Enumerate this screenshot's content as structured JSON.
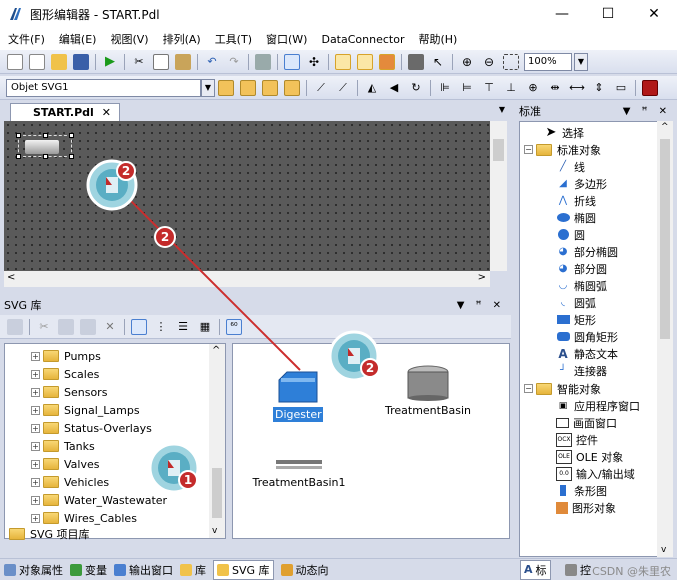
{
  "window": {
    "title": "图形编辑器 - START.Pdl",
    "minimize": "—",
    "maximize": "☐",
    "close": "✕"
  },
  "menu": [
    "文件(F)",
    "编辑(E)",
    "视图(V)",
    "排列(A)",
    "工具(T)",
    "窗口(W)",
    "DataConnector",
    "帮助(H)"
  ],
  "toolbar": {
    "zoom": "100%"
  },
  "objectbar": {
    "selected_object": "Objet SVG1"
  },
  "editor": {
    "tab_label": "START.Pdl",
    "tab_close": "✕"
  },
  "svg_library": {
    "title": "SVG 库",
    "folders": [
      "Pumps",
      "Scales",
      "Sensors",
      "Signal_Lamps",
      "Status-Overlays",
      "Tanks",
      "Valves",
      "Vehicles",
      "Water_Wastewater",
      "Wires_Cables"
    ],
    "project_lib": "SVG 项目库",
    "items": [
      "Digester",
      "TreatmentBasin",
      "TreatmentBasin1"
    ]
  },
  "callouts": [
    "1",
    "2",
    "2",
    "2"
  ],
  "standard_panel": {
    "title": "标准",
    "items": [
      {
        "label": "选择",
        "icon": "arrow-pointer-icon"
      },
      {
        "label": "标准对象",
        "icon": "folder-icon"
      },
      {
        "label": "线",
        "icon": "line-icon"
      },
      {
        "label": "多边形",
        "icon": "polygon-icon"
      },
      {
        "label": "折线",
        "icon": "polyline-icon"
      },
      {
        "label": "椭圆",
        "icon": "ellipse-icon"
      },
      {
        "label": "圆",
        "icon": "circle-icon"
      },
      {
        "label": "部分椭圆",
        "icon": "partial-ellipse-icon"
      },
      {
        "label": "部分圆",
        "icon": "partial-circle-icon"
      },
      {
        "label": "椭圆弧",
        "icon": "ellipse-arc-icon"
      },
      {
        "label": "圆弧",
        "icon": "arc-icon"
      },
      {
        "label": "矩形",
        "icon": "rectangle-icon"
      },
      {
        "label": "圆角矩形",
        "icon": "rounded-rectangle-icon"
      },
      {
        "label": "静态文本",
        "icon": "text-icon"
      },
      {
        "label": "连接器",
        "icon": "connector-icon"
      },
      {
        "label": "智能对象",
        "icon": "folder-icon"
      },
      {
        "label": "应用程序窗口",
        "icon": "app-window-icon"
      },
      {
        "label": "画面窗口",
        "icon": "picture-window-icon"
      },
      {
        "label": "控件",
        "icon": "control-icon"
      },
      {
        "label": "OLE 对象",
        "icon": "ole-icon"
      },
      {
        "label": "输入/输出域",
        "icon": "io-field-icon"
      },
      {
        "label": "条形图",
        "icon": "bar-icon"
      },
      {
        "label": "图形对象",
        "icon": "graphic-object-icon"
      }
    ]
  },
  "statusbar": {
    "tabs": [
      "对象属性",
      "变量",
      "输出窗口",
      "库",
      "SVG 库",
      "动态向"
    ],
    "right_tabs": [
      "标",
      "控"
    ],
    "watermark": "CSDN @朱里农"
  }
}
